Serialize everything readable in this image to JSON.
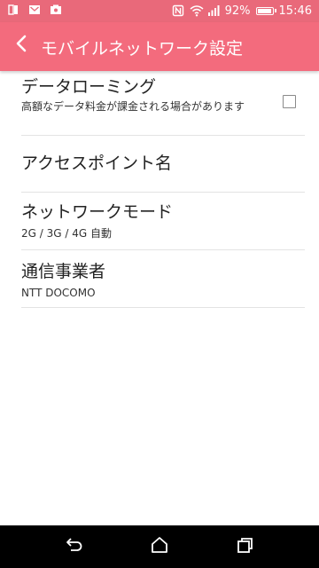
{
  "status_bar": {
    "battery_percent": "92%",
    "time": "15:46",
    "icons": [
      "sim-icon",
      "mail-icon",
      "photo-icon",
      "nfc-icon",
      "wifi-icon",
      "signal-icon",
      "battery-icon"
    ]
  },
  "app_bar": {
    "title": "モバイルネットワーク設定",
    "back_icon": "chevron-left-icon"
  },
  "settings": [
    {
      "title": "データローミング",
      "subtitle": "高額なデータ料金が課金される場合があります",
      "checked": false
    },
    {
      "title": "アクセスポイント名"
    },
    {
      "title": "ネットワークモード",
      "subtitle": "2G / 3G / 4G 自動"
    },
    {
      "title": "通信事業者",
      "subtitle": "NTT DOCOMO"
    }
  ],
  "nav_bar": {
    "buttons": [
      "back-icon",
      "home-icon",
      "recents-icon"
    ]
  },
  "colors": {
    "status_bar": "#e9697a",
    "app_bar": "#f36b7d",
    "nav_bar": "#000000"
  }
}
